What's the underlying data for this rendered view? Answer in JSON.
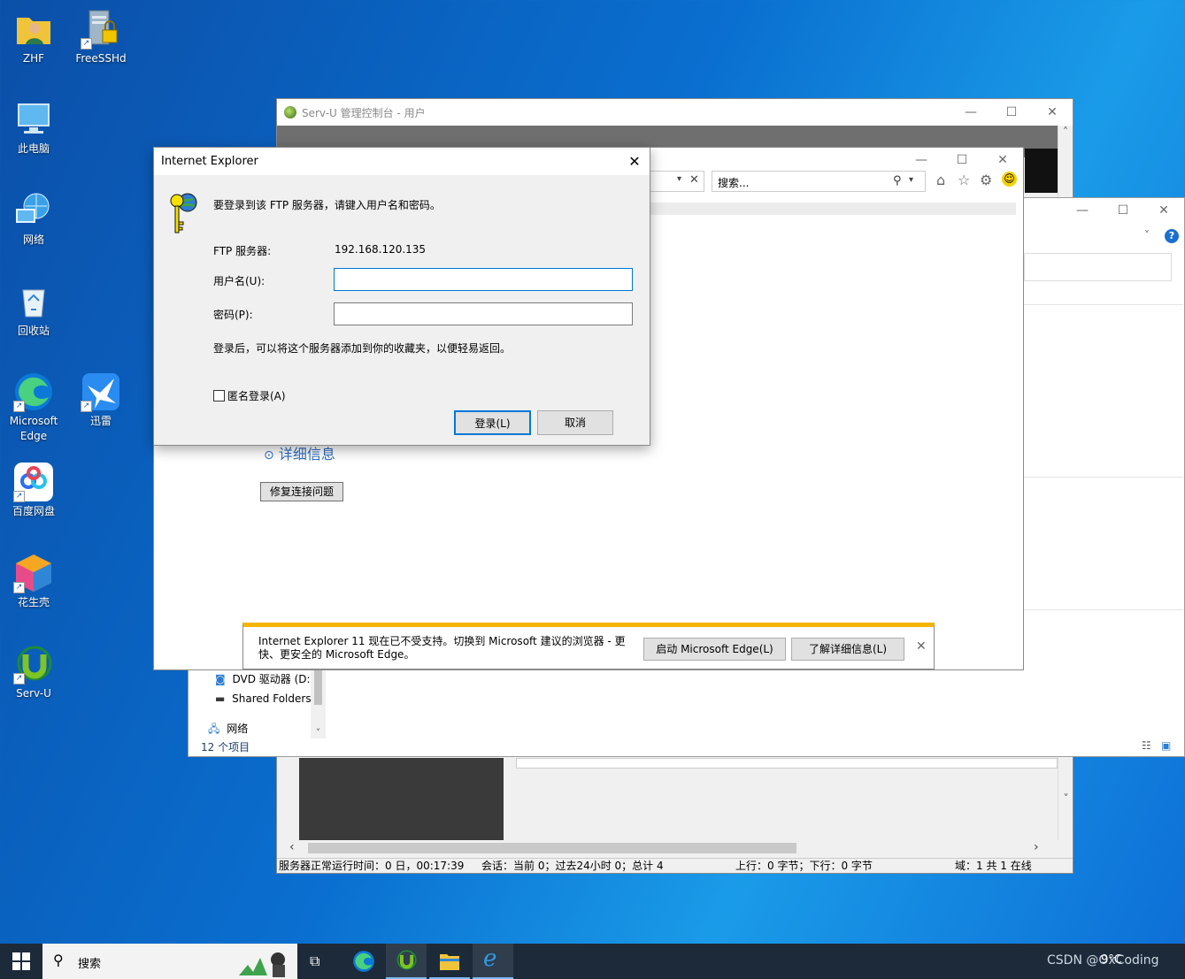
{
  "desktop": {
    "icons": [
      {
        "label": "ZHF"
      },
      {
        "label": "FreeSSHd"
      },
      {
        "label": "此电脑"
      },
      {
        "label": "网络"
      },
      {
        "label": "回收站"
      },
      {
        "label": "Microsoft Edge"
      },
      {
        "label": "迅雷"
      },
      {
        "label": "百度网盘"
      },
      {
        "label": "花生壳"
      },
      {
        "label": "Serv-U"
      }
    ]
  },
  "servu": {
    "title": "Serv-U 管理控制台 - 用户",
    "status": {
      "uptime": "服务器正常运行时间：0 日，00:17:39",
      "sessions": "会话：当前 0；过去24小时 0；总计 4",
      "traffic": "上行：0 字节；下行：0 字节",
      "domains": "域：1 共 1 在线"
    }
  },
  "explorer": {
    "tree": {
      "dvd": "DVD 驱动器 (D:",
      "shared": "Shared Folders",
      "network": "网络"
    },
    "item_count": "12 个项目"
  },
  "ie": {
    "search_placeholder": "搜索...",
    "details_link": "详细信息",
    "fix_button": "修复连接问题"
  },
  "dialog": {
    "title": "Internet Explorer",
    "prompt": "要登录到该 FTP 服务器，请键入用户名和密码。",
    "server_label": "FTP 服务器:",
    "server_value": "192.168.120.135",
    "username_label": "用户名(U):",
    "password_label": "密码(P):",
    "username_value": "",
    "password_value": "",
    "note": "登录后，可以将这个服务器添加到你的收藏夹，以便轻易返回。",
    "anonymous_label": "匿名登录(A)",
    "login_button": "登录(L)",
    "cancel_button": "取消"
  },
  "notification": {
    "message": "Internet Explorer 11 现在已不受支持。切换到 Microsoft 建议的浏览器 - 更快、更安全的 Microsoft Edge。",
    "edge_button": "启动 Microsoft Edge(L)",
    "learn_button": "了解详细信息(L)"
  },
  "taskbar": {
    "search_label": "搜索",
    "tray_text": "CSDN @OxCoding",
    "weather": "9°C"
  }
}
